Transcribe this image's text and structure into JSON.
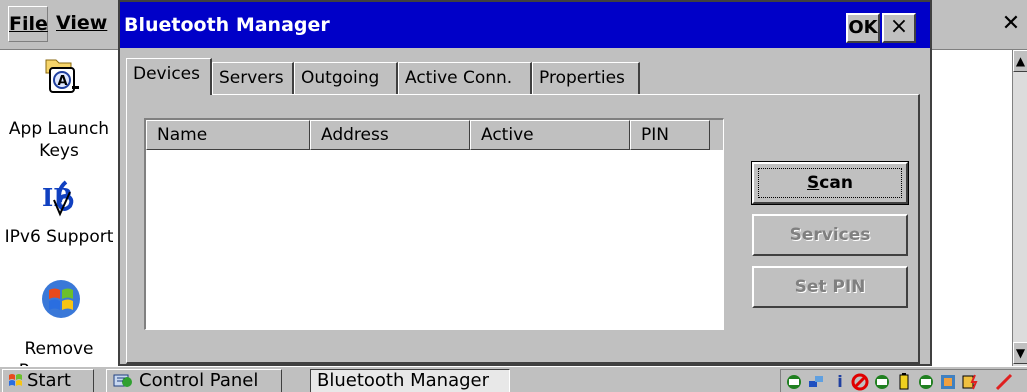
{
  "background_window": {
    "menu": {
      "file": "File",
      "view": "View"
    },
    "icons": [
      {
        "label": "App Launch Keys",
        "icon": "app-launch-keys-icon"
      },
      {
        "label": "IPv6 Support",
        "icon": "ipv6-icon"
      },
      {
        "label": "Remove Programs",
        "icon": "windows-flag-icon"
      }
    ]
  },
  "dialog": {
    "title": "Bluetooth Manager",
    "ok_label": "OK",
    "close_label": "×",
    "tabs": [
      {
        "label": "Devices",
        "active": true
      },
      {
        "label": "Servers"
      },
      {
        "label": "Outgoing"
      },
      {
        "label": "Active Conn."
      },
      {
        "label": "Properties"
      }
    ],
    "list_columns": [
      "Name",
      "Address",
      "Active",
      "PIN"
    ],
    "list_rows": [],
    "buttons": {
      "scan": "Scan",
      "services": "Services",
      "set_pin": "Set PIN"
    }
  },
  "taskbar": {
    "start": "Start",
    "items": [
      "Control Panel",
      "Bluetooth Manager"
    ]
  },
  "colors": {
    "title_bar": "#0000c8",
    "face": "#c0c0c0"
  }
}
